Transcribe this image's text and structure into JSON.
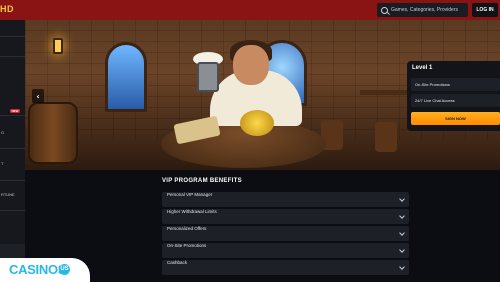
{
  "header": {
    "logo_fragment": "HD",
    "search_placeholder": "Games, Categories, Providers",
    "login_label": "LOG IN"
  },
  "sidebar": {
    "badge": "NEW",
    "items": [
      {
        "label": "G"
      },
      {
        "label": "T"
      },
      {
        "label": "RTUNE"
      }
    ]
  },
  "hero": {
    "prev_arrow": "‹"
  },
  "vip_card": {
    "level": "Level 1",
    "perks": [
      "On-Site Promotions",
      "24/7 Live Chat Access"
    ],
    "cta": "SIGN NOW"
  },
  "benefits": {
    "title": "VIP PROGRAM BENEFITS",
    "items": [
      "Personal VIP Manager",
      "Higher Withdrawal Limits",
      "Personalized Offers",
      "On-Site Promotions",
      "Cashback"
    ]
  },
  "footer": {
    "brand": "CASINOS",
    "brand_badge": "US"
  }
}
